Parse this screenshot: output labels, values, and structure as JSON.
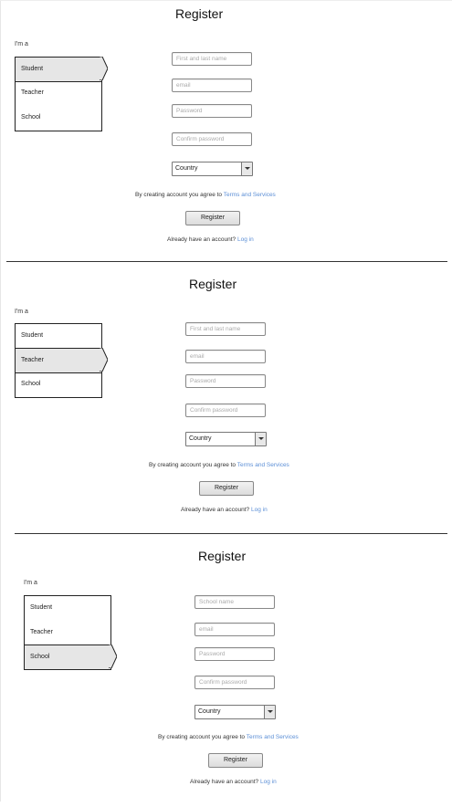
{
  "sections": [
    {
      "title": "Register",
      "role_label": "I'm a",
      "roles": [
        "Student",
        "Teacher",
        "School"
      ],
      "selected_role": "Student",
      "name_placeholder": "First and last name",
      "email_placeholder": "email",
      "password_placeholder": "Password",
      "confirm_placeholder": "Confirm password",
      "country_value": "Country",
      "terms_text": "By creating account you agree to",
      "terms_link": "Terms and Services",
      "register_label": "Register",
      "login_text": "Already have an account?",
      "login_link": "Log in"
    },
    {
      "title": "Register",
      "role_label": "I'm a",
      "roles": [
        "Student",
        "Teacher",
        "School"
      ],
      "selected_role": "Teacher",
      "name_placeholder": "First and last name",
      "email_placeholder": "email",
      "password_placeholder": "Password",
      "confirm_placeholder": "Confirm password",
      "country_value": "Country",
      "terms_text": "By creating account you agree to",
      "terms_link": "Terms and Services",
      "register_label": "Register",
      "login_text": "Already have an account?",
      "login_link": "Log in"
    },
    {
      "title": "Register",
      "role_label": "I'm a",
      "roles": [
        "Student",
        "Teacher",
        "School"
      ],
      "selected_role": "School",
      "name_placeholder": "School name",
      "email_placeholder": "email",
      "password_placeholder": "Password",
      "confirm_placeholder": "Confirm password",
      "country_value": "Country",
      "terms_text": "By creating account you agree to",
      "terms_link": "Terms and Services",
      "register_label": "Register",
      "login_text": "Already have an account?",
      "login_link": "Log in"
    }
  ],
  "colors": {
    "link": "#5c8fd6",
    "selected_bg": "#e6e6e6",
    "border": "#222222"
  }
}
